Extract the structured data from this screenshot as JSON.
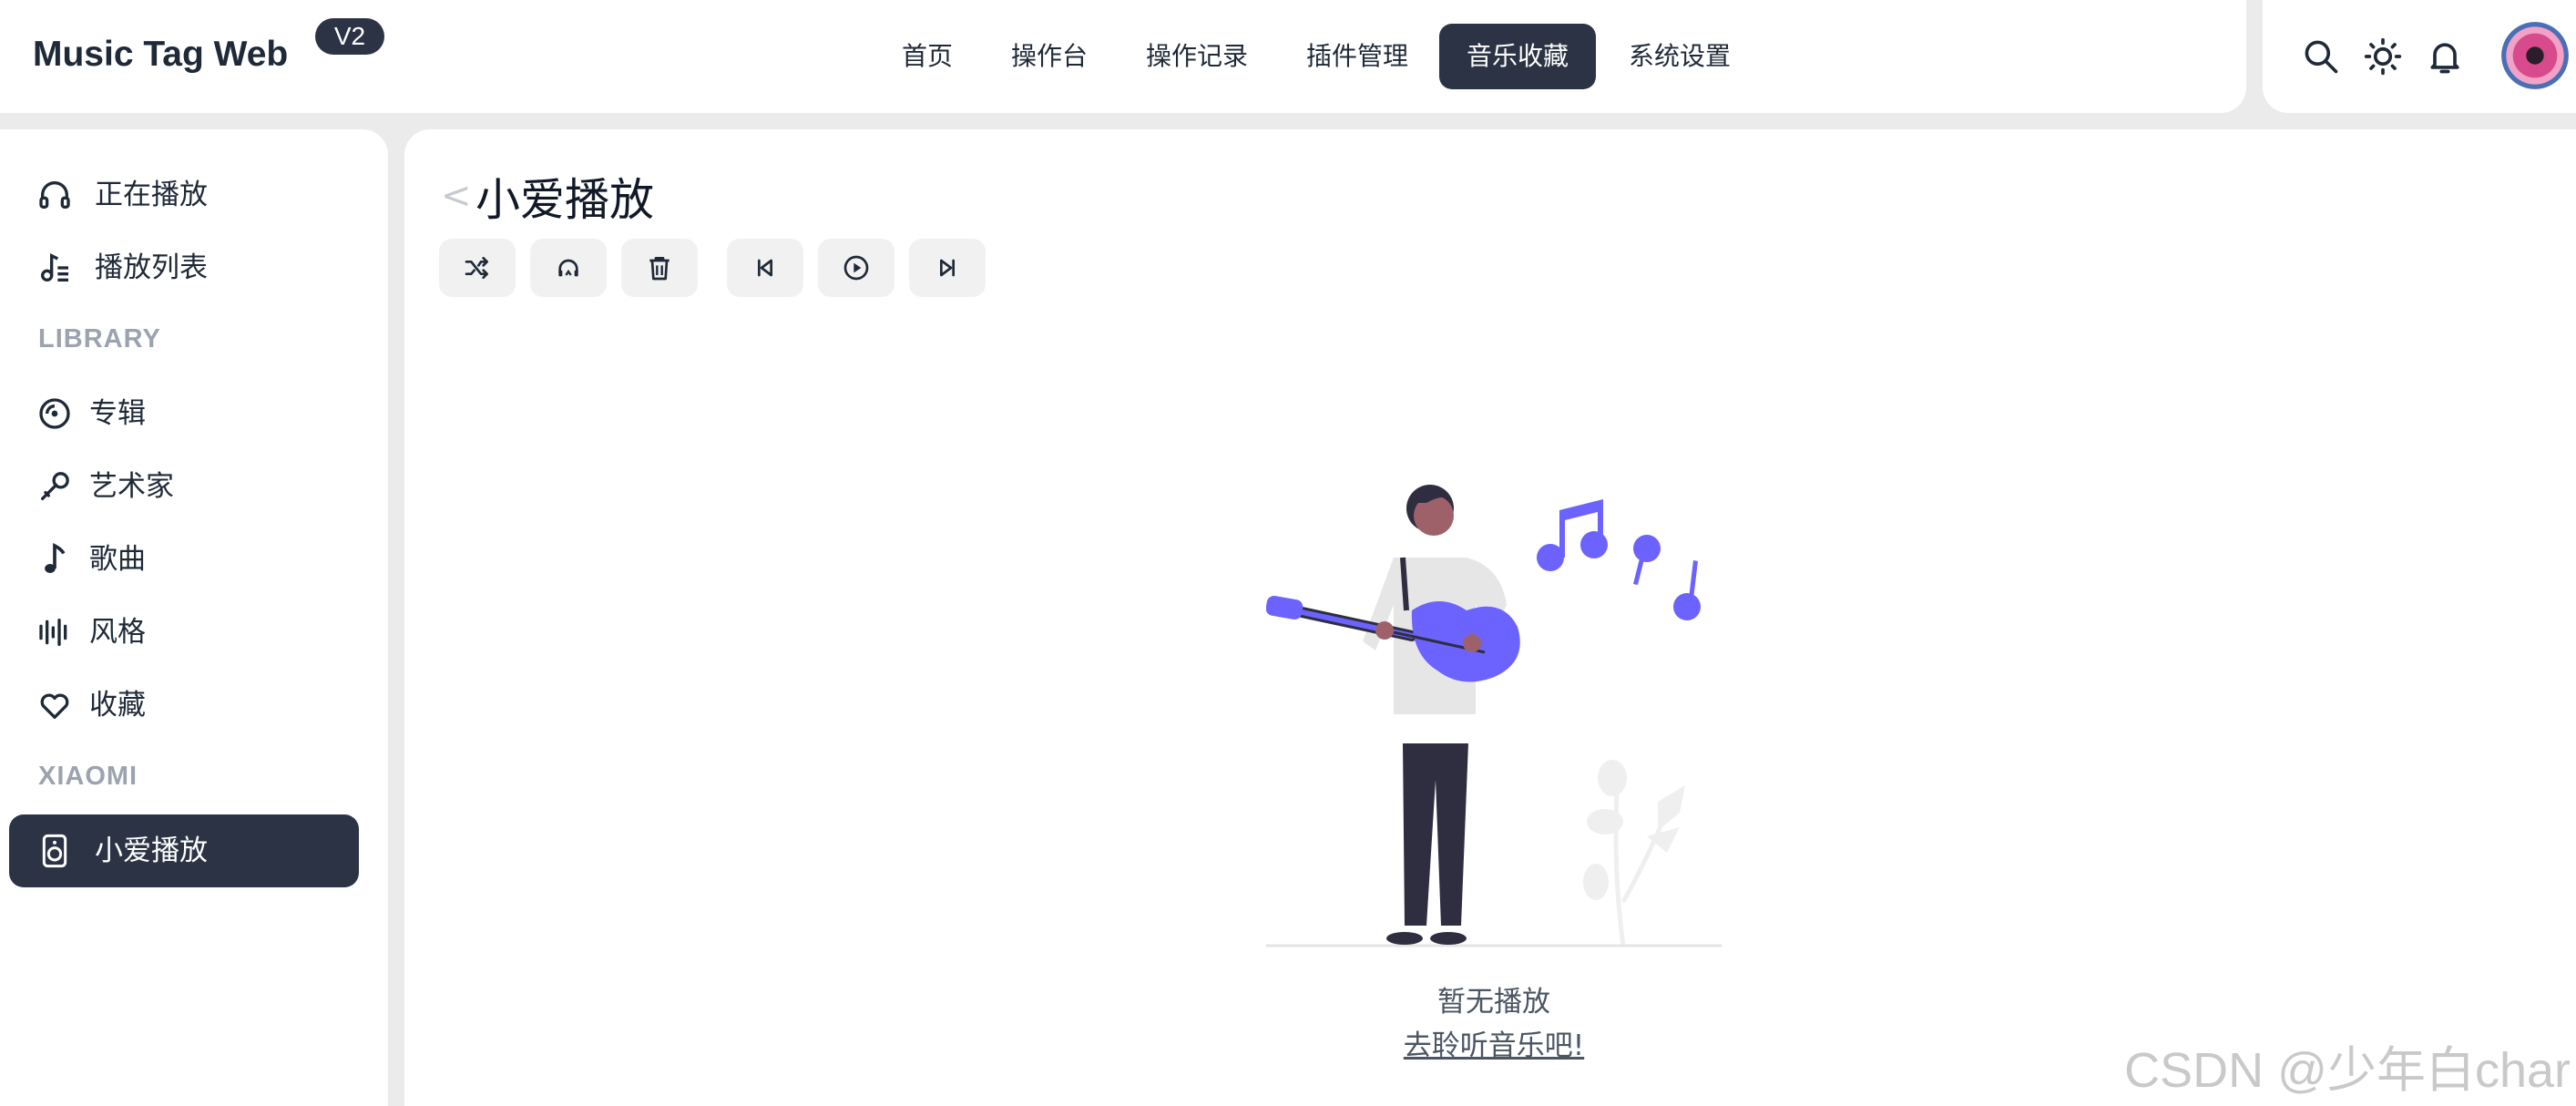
{
  "app": {
    "title": "Music Tag Web",
    "version": "V2"
  },
  "nav": {
    "items": [
      {
        "label": "首页"
      },
      {
        "label": "操作台"
      },
      {
        "label": "操作记录"
      },
      {
        "label": "插件管理"
      },
      {
        "label": "音乐收藏",
        "active": true
      },
      {
        "label": "系统设置"
      }
    ]
  },
  "header_actions": [
    "search-icon",
    "sun-icon",
    "bell-icon",
    "avatar"
  ],
  "sidebar": {
    "top": [
      {
        "label": "正在播放",
        "icon": "headphones-icon"
      },
      {
        "label": "播放列表",
        "icon": "music-list-icon"
      }
    ],
    "library_heading": "LIBRARY",
    "library": [
      {
        "label": "专辑",
        "icon": "disc-icon"
      },
      {
        "label": "艺术家",
        "icon": "microphone-icon"
      },
      {
        "label": "歌曲",
        "icon": "music-note-icon"
      },
      {
        "label": "风格",
        "icon": "waveform-icon"
      },
      {
        "label": "收藏",
        "icon": "heart-icon"
      }
    ],
    "xiaomi_heading": "XIAOMI",
    "xiaomi": [
      {
        "label": "小爱播放",
        "icon": "speaker-icon",
        "active": true
      }
    ]
  },
  "main": {
    "back_glyph": "<",
    "title": "小爱播放",
    "toolbar": [
      "shuffle-icon",
      "headset-icon",
      "trash-icon",
      "previous-icon",
      "play-icon",
      "next-icon"
    ],
    "empty": {
      "text": "暂无播放",
      "link": "去聆听音乐吧!"
    }
  },
  "watermark": "CSDN @少年白char",
  "colors": {
    "accent": "#2b3344",
    "illustration": "#6c63ff"
  }
}
